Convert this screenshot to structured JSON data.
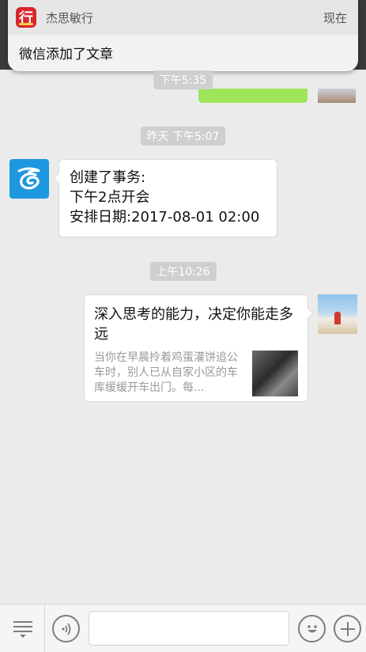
{
  "notification": {
    "app_icon_char": "行",
    "app_name": "杰思敏行",
    "time": "现在",
    "message": "微信添加了文章"
  },
  "timestamps": {
    "t1": "下午5:35",
    "t2": "昨天 下午5:07",
    "t3": "上午10:26"
  },
  "task_message": {
    "line1": "创建了事务:",
    "line2": "下午2点开会",
    "line3": "安排日期:2017-08-01 02:00"
  },
  "article_message": {
    "title": "深入思考的能力，决定你能走多远",
    "description": "当你在早晨拎着鸡蛋灌饼追公车时，别人已从自家小区的车库缓缓开车出门。每..."
  },
  "input_bar": {
    "placeholder": ""
  },
  "icons": {
    "menu": "list-menu-icon",
    "voice": "voice-icon",
    "emoji": "emoji-icon",
    "plus": "plus-icon",
    "service": "service-logo-icon"
  },
  "colors": {
    "sent_bubble": "#9ee559",
    "service_avatar": "#1d98e0",
    "app_icon": "#d8262d",
    "background": "#ebebeb"
  }
}
